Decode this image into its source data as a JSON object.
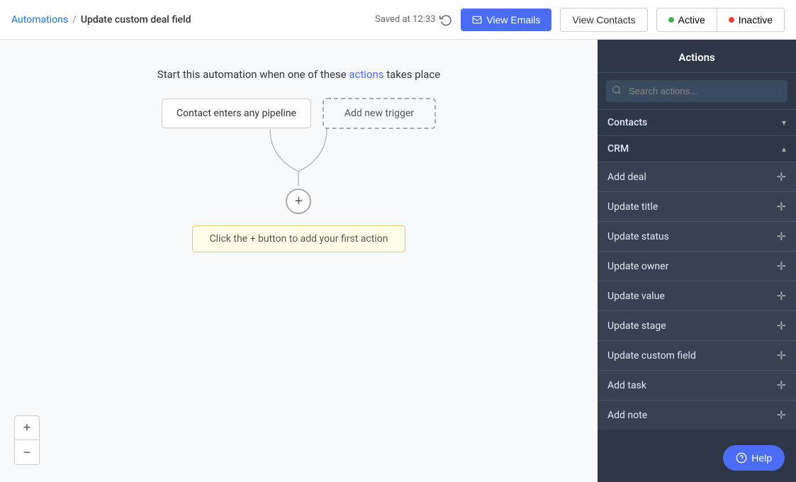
{
  "header": {
    "breadcrumb_link": "Automations",
    "breadcrumb_sep": "/",
    "breadcrumb_current": "Update custom deal field",
    "saved_label": "Saved at 12:33",
    "btn_view_emails": "View Emails",
    "btn_view_contacts": "View Contacts",
    "status_active": "Active",
    "status_inactive": "Inactive"
  },
  "canvas": {
    "automation_text_1": "Start this automation when one of these ",
    "automation_highlight": "actions",
    "automation_text_2": " takes place",
    "trigger_1": "Contact enters any pipeline",
    "trigger_2": "Add new trigger",
    "hint_text": "Click the + button to add your first action",
    "zoom_in": "+",
    "zoom_out": "−"
  },
  "actions_sidebar": {
    "title": "Actions",
    "search_placeholder": "Search actions...",
    "sections": [
      {
        "label": "Contacts",
        "expanded": false,
        "items": []
      },
      {
        "label": "CRM",
        "expanded": true,
        "items": [
          {
            "label": "Add deal"
          },
          {
            "label": "Update title"
          },
          {
            "label": "Update status"
          },
          {
            "label": "Update owner"
          },
          {
            "label": "Update value"
          },
          {
            "label": "Update stage"
          },
          {
            "label": "Update custom field"
          },
          {
            "label": "Add task"
          },
          {
            "label": "Add note"
          }
        ]
      }
    ]
  },
  "help_btn": "Help"
}
